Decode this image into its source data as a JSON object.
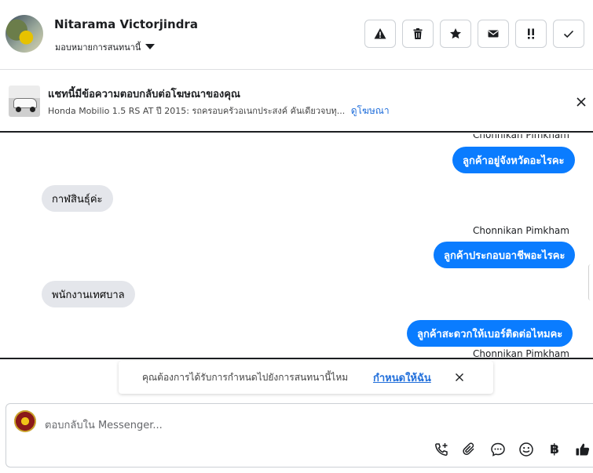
{
  "header": {
    "name": "Nitarama Victorjindra",
    "assign_label": "มอบหมายการสนทนานี้",
    "actions": [
      {
        "icon": "warning-icon"
      },
      {
        "icon": "trash-icon"
      },
      {
        "icon": "star-icon"
      },
      {
        "icon": "mail-icon"
      },
      {
        "icon": "follow-up-icon",
        "label": "!!"
      },
      {
        "icon": "check-icon"
      }
    ]
  },
  "ad": {
    "title": "แชทนี้มีข้อความตอบกลับต่อโฆษณาของคุณ",
    "description": "Honda Mobilio 1.5 RS AT ปี 2015: รถครอบครัวอเนกประสงค์ คันเดียวจบทุ...",
    "link": "ดูโฆษณา"
  },
  "messages": [
    {
      "direction": "out",
      "sender": "Chonnikan Pimkham",
      "text": "ลูกค้าอยู่จังหวัดอะไรคะ"
    },
    {
      "direction": "in",
      "text": "กาฬสินธุ์ค่ะ"
    },
    {
      "direction": "out",
      "sender": "Chonnikan Pimkham",
      "text": "ลูกค้าประกอบอาชีพอะไรคะ"
    },
    {
      "direction": "in",
      "text": "พนักงานเทศบาล"
    },
    {
      "direction": "out",
      "sender": "Chonnikan Pimkham",
      "text": "ลูกค้าสะดวกให้เบอร์ติดต่อไหมคะ"
    }
  ],
  "suggestion": {
    "text": "คุณต้องการได้รับการกำหนดไปยังการสนทนานี้ไหม",
    "link": "กำหนดให้ฉัน"
  },
  "composer": {
    "placeholder": "ตอบกลับใน Messenger...",
    "tools": [
      "phone-plus-icon",
      "attach-icon",
      "chat-bubble-icon",
      "emoji-icon",
      "baht-icon",
      "thumbs-up-icon"
    ],
    "currency_symbol": "฿"
  },
  "colors": {
    "accent": "#0a7cff",
    "link": "#216fdb",
    "incoming_bubble": "#e4e6eb"
  }
}
